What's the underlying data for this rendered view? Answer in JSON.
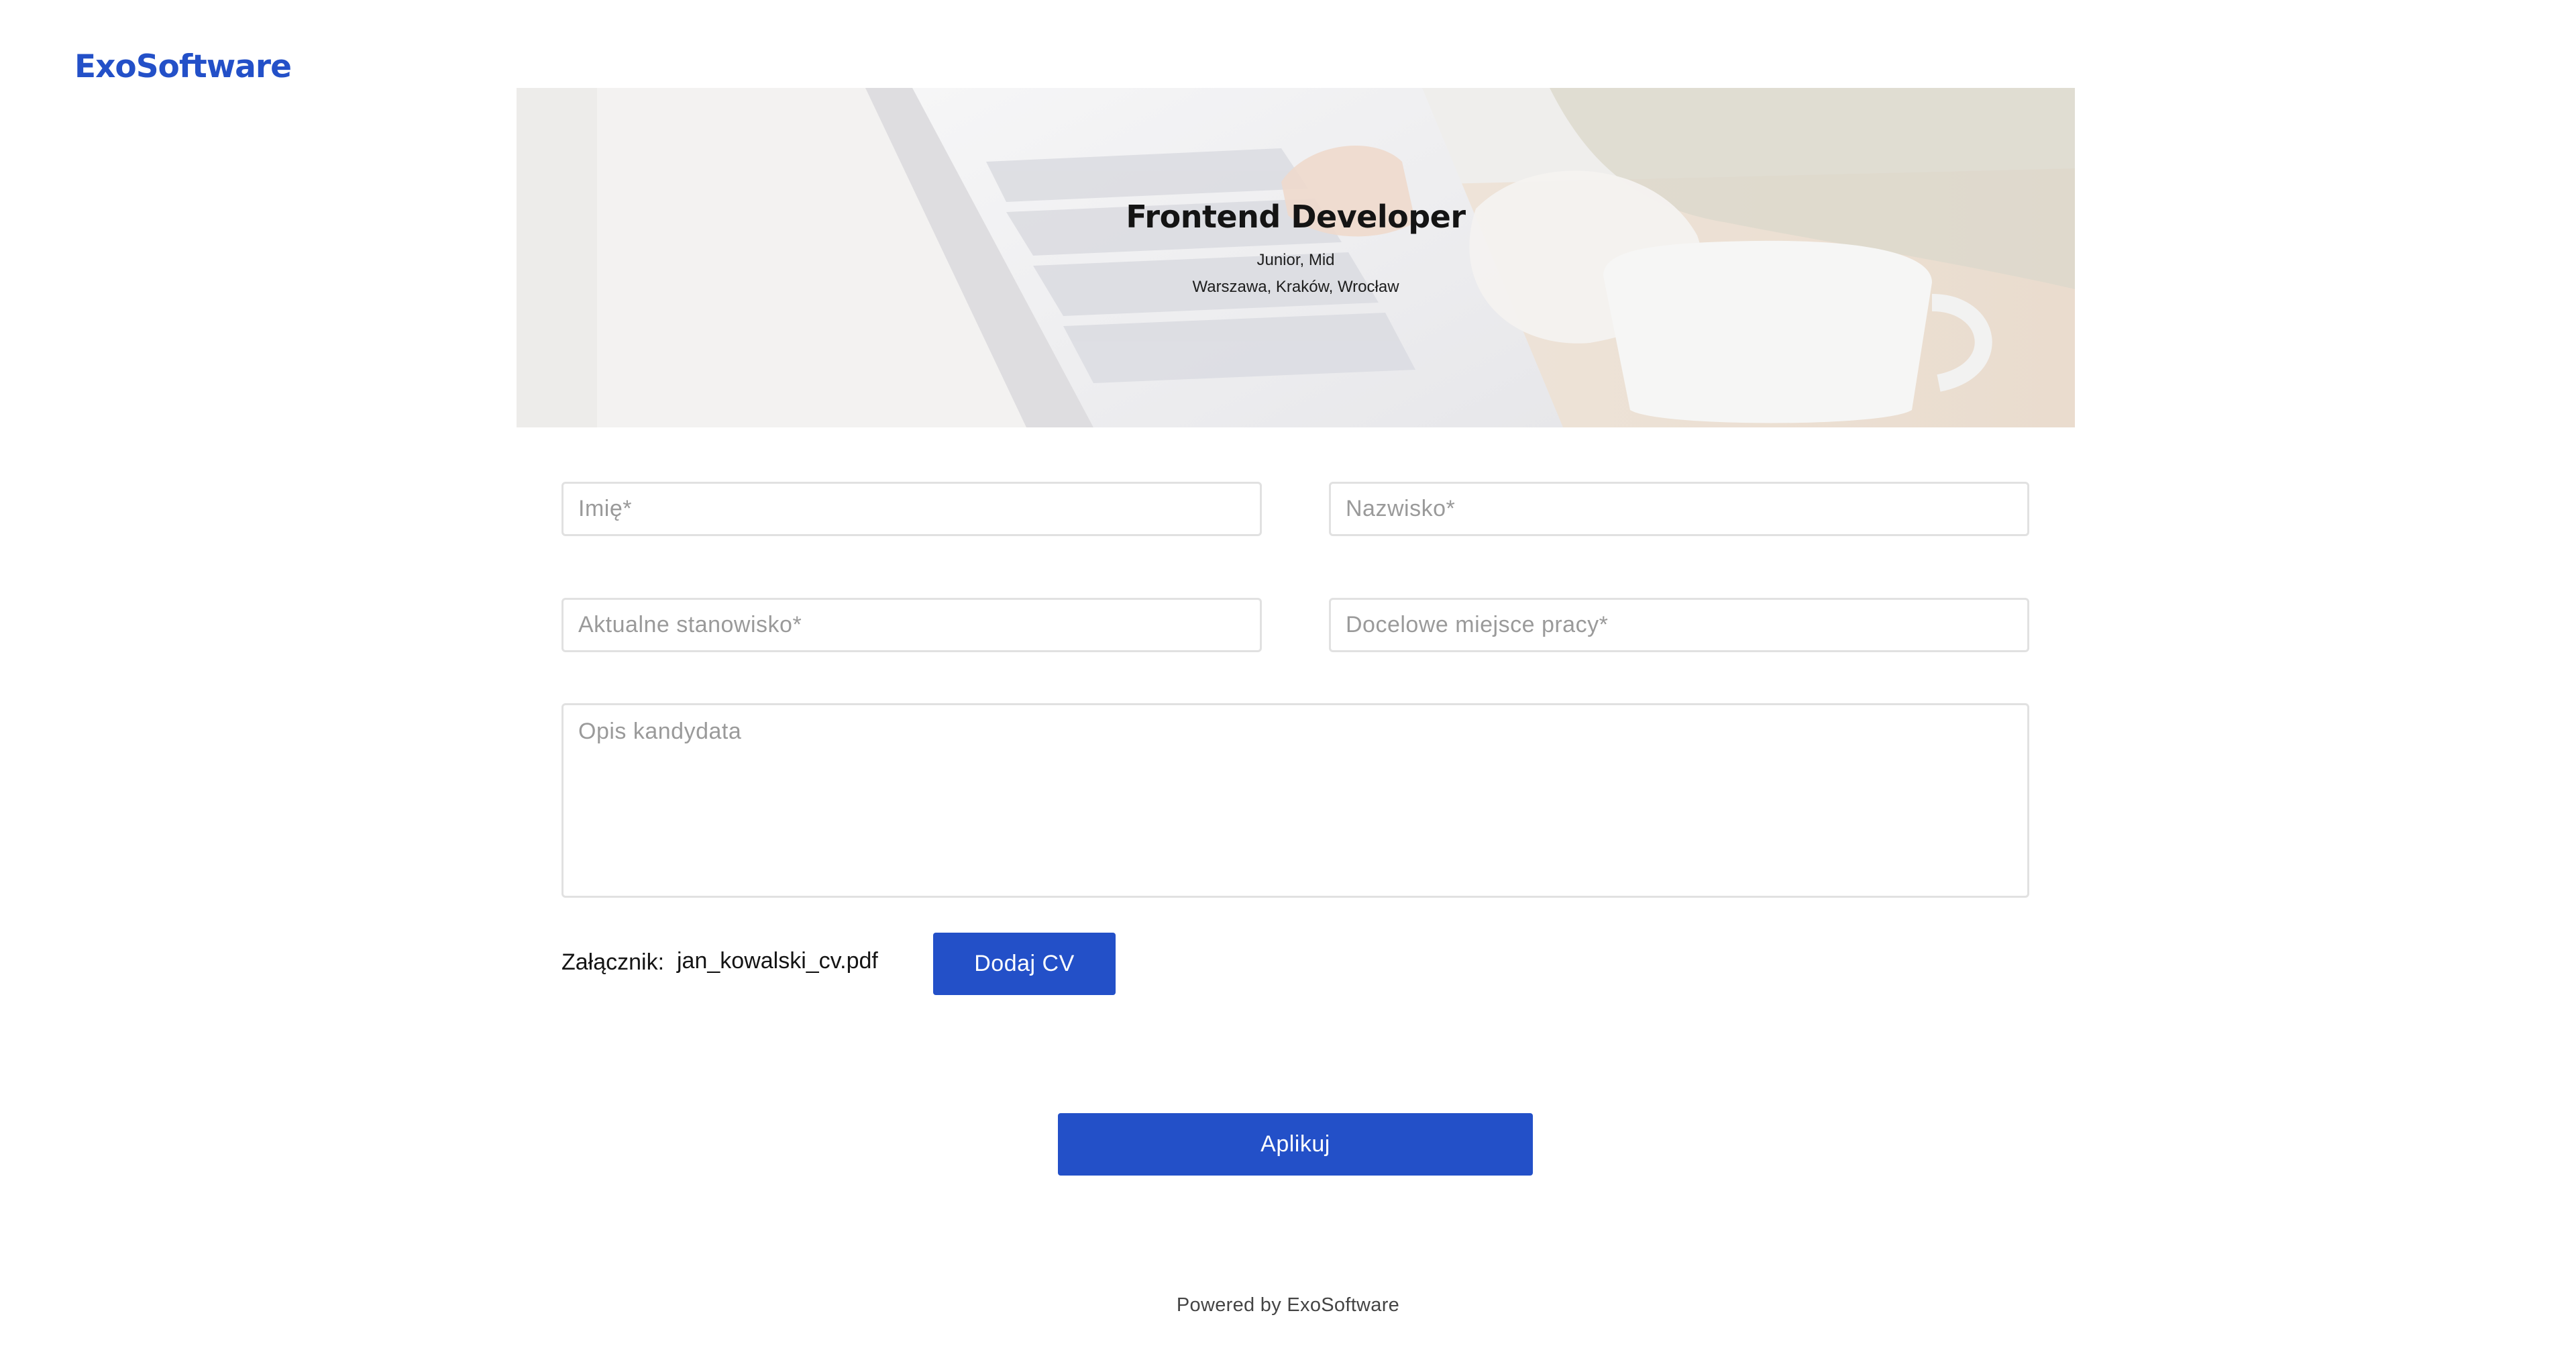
{
  "brand": {
    "name": "ExoSoftware",
    "color": "#2350c8"
  },
  "job": {
    "title": "Frontend Developer",
    "levels": "Junior, Mid",
    "locations": "Warszawa, Kraków, Wrocław"
  },
  "form": {
    "first_name": {
      "placeholder": "Imię*",
      "value": ""
    },
    "last_name": {
      "placeholder": "Nazwisko*",
      "value": ""
    },
    "current_position": {
      "placeholder": "Aktualne stanowisko*",
      "value": ""
    },
    "target_workplace": {
      "placeholder": "Docelowe miejsce pracy*",
      "value": ""
    },
    "description": {
      "placeholder": "Opis kandydata",
      "value": ""
    },
    "attachment_label": "Załącznik:",
    "attachment_filename": "jan_kowalski_cv.pdf",
    "add_cv_label": "Dodaj CV",
    "submit_label": "Aplikuj"
  },
  "footer": {
    "text": "Powered by ExoSoftware"
  }
}
